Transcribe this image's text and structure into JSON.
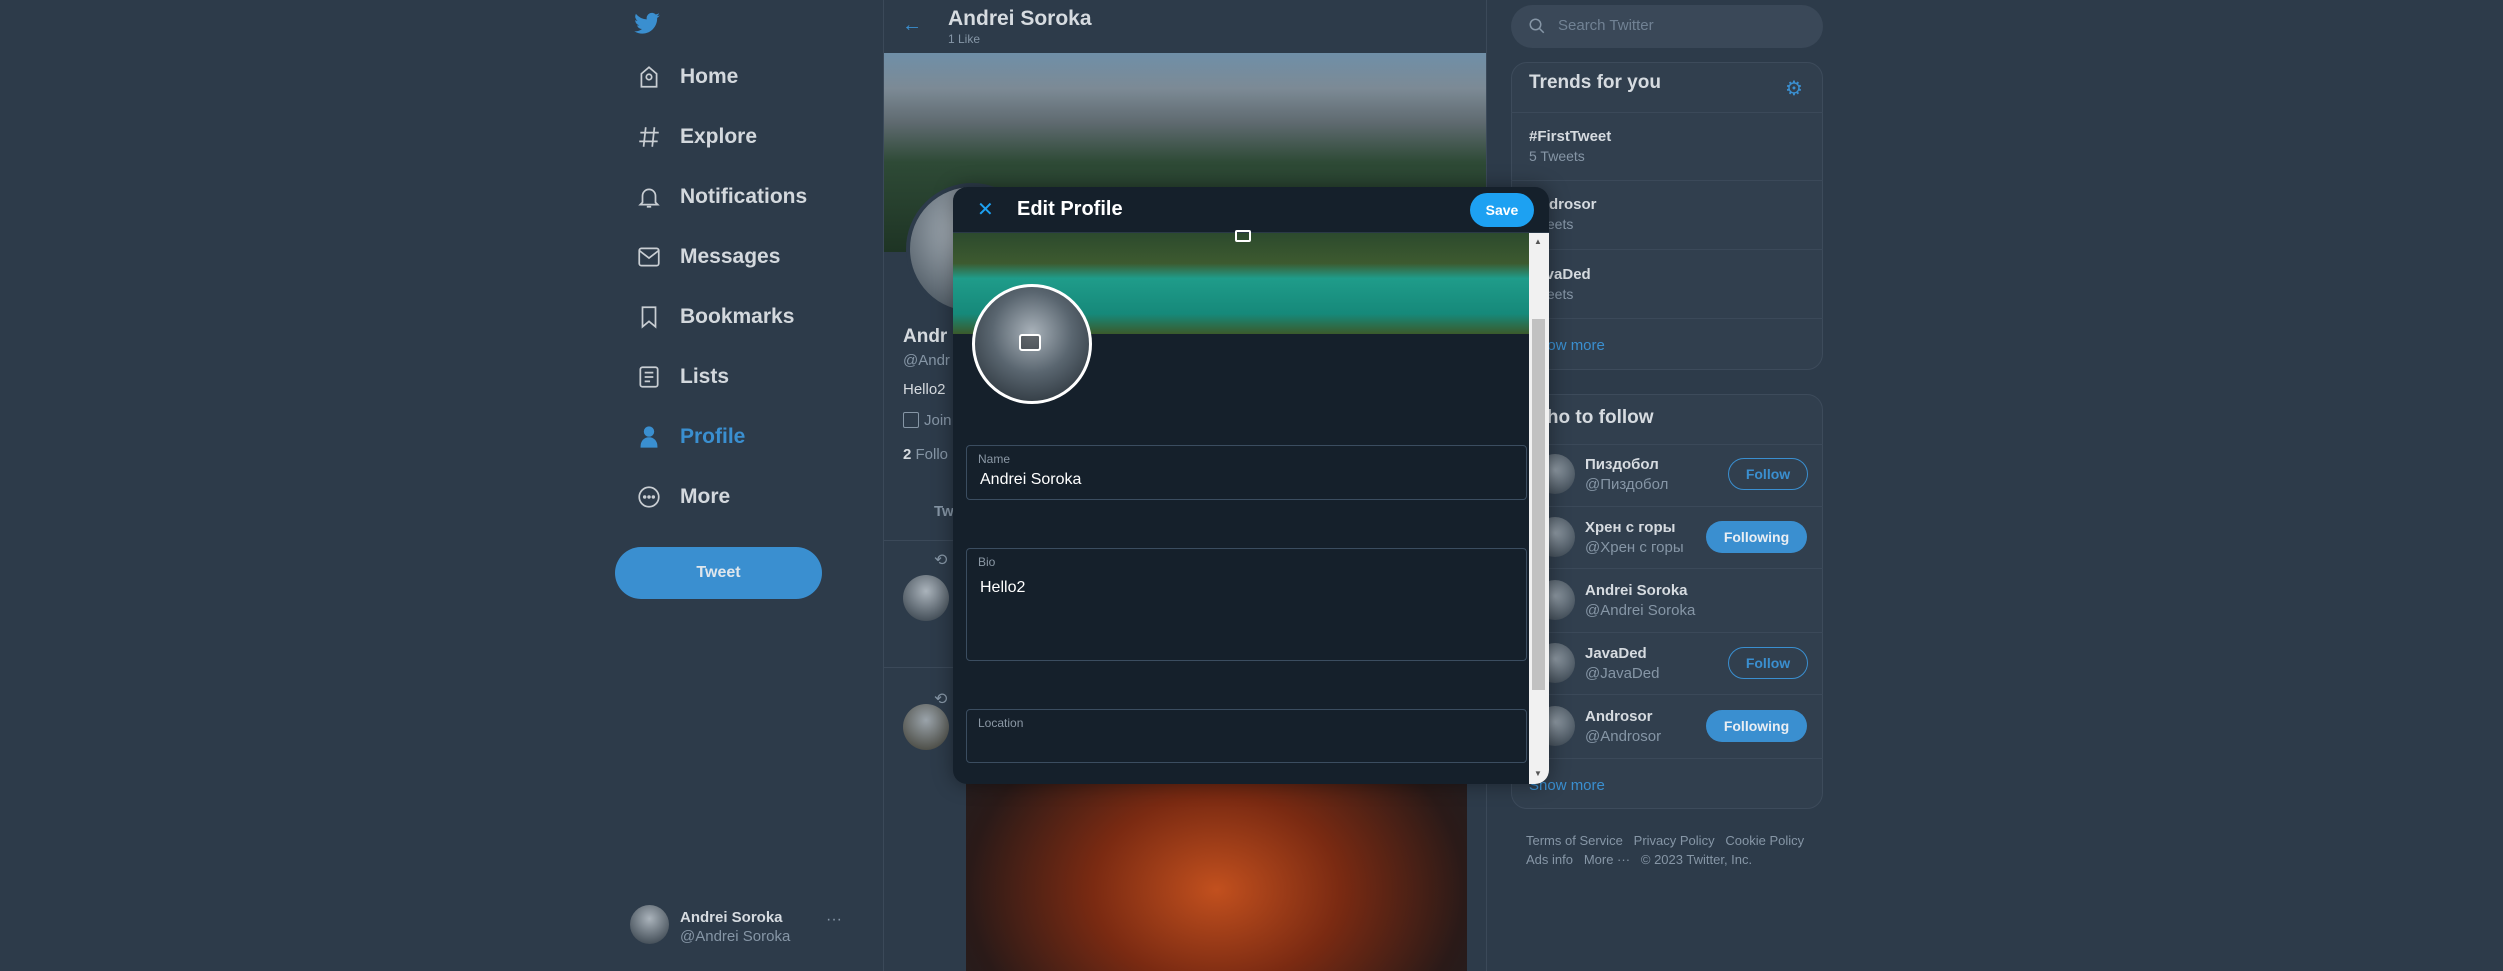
{
  "sidebar": {
    "items": [
      {
        "label": "Home",
        "icon": "home-icon"
      },
      {
        "label": "Explore",
        "icon": "hashtag-icon"
      },
      {
        "label": "Notifications",
        "icon": "bell-icon"
      },
      {
        "label": "Messages",
        "icon": "mail-icon"
      },
      {
        "label": "Bookmarks",
        "icon": "bookmark-icon"
      },
      {
        "label": "Lists",
        "icon": "list-icon"
      },
      {
        "label": "Profile",
        "icon": "person-icon",
        "active": true
      },
      {
        "label": "More",
        "icon": "more-circle-icon"
      }
    ],
    "tweet_label": "Tweet",
    "account": {
      "name": "Andrei Soroka",
      "handle": "@Andrei Soroka"
    }
  },
  "header": {
    "name": "Andrei Soroka",
    "subtitle": "1 Like"
  },
  "profile": {
    "name": "Andr",
    "handle": "@Andr",
    "bio": "Hello2",
    "joined": "Join",
    "followers_count": "2",
    "followers_label": "Follo",
    "tab": "Tw"
  },
  "modal": {
    "title": "Edit Profile",
    "save_label": "Save",
    "fields": {
      "name_label": "Name",
      "name_value": "Andrei Soroka",
      "bio_label": "Bio",
      "bio_value": "Hello2",
      "location_label": "Location",
      "location_value": ""
    }
  },
  "search": {
    "placeholder": "Search Twitter"
  },
  "trends": {
    "title": "Trends for you",
    "items": [
      {
        "name": "#FirstTweet",
        "count": "5 Tweets"
      },
      {
        "name": "Androsor",
        "count": "Tweets"
      },
      {
        "name": "JavaDed",
        "count": "Tweets"
      }
    ],
    "show_more": "Show more"
  },
  "who_to_follow": {
    "title": "Who to follow",
    "users": [
      {
        "name": "Пиздобол",
        "handle": "@Пиздобол",
        "button": "Follow"
      },
      {
        "name": "Хрен с горы",
        "handle": "@Хрен с горы",
        "button": "Following"
      },
      {
        "name": "Andrei Soroka",
        "handle": "@Andrei Soroka",
        "button": ""
      },
      {
        "name": "JavaDed",
        "handle": "@JavaDed",
        "button": "Follow"
      },
      {
        "name": "Androsor",
        "handle": "@Androsor",
        "button": "Following"
      }
    ],
    "show_more": "Show more"
  },
  "footer": {
    "links": [
      "Terms of Service",
      "Privacy Policy",
      "Cookie Policy",
      "Ads info",
      "More ···"
    ],
    "copyright": "© 2023 Twitter, Inc."
  },
  "colors": {
    "accent": "#1da1f2",
    "accent_dim": "#3a8fd0",
    "modal_bg": "#15202b",
    "page_bg": "#2d3b4a"
  }
}
